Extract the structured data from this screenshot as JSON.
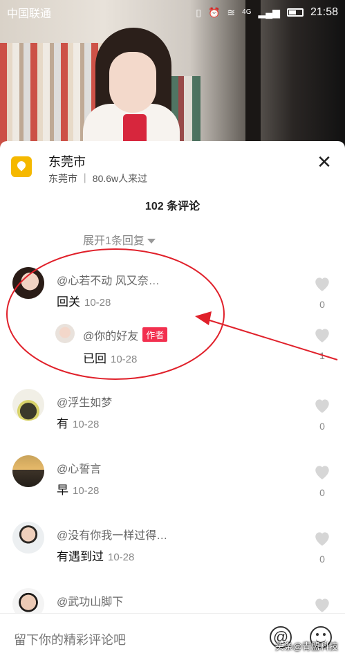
{
  "status_bar": {
    "carrier": "中国联通",
    "time": "21:58",
    "network_label": "4G"
  },
  "location": {
    "title": "东莞市",
    "subtitle": "东莞市 ｜ 80.6w人来过"
  },
  "comments_header": {
    "count_title": "102 条评论",
    "expand_label": "展开1条回复"
  },
  "comments": [
    {
      "user": "@心若不动 风又奈…",
      "text": "回关",
      "date": "10-28",
      "likes": "0"
    },
    {
      "user": "@浮生如梦",
      "text": "有",
      "date": "10-28",
      "likes": "0"
    },
    {
      "user": "@心誓言",
      "text": "早",
      "date": "10-28",
      "likes": "0"
    },
    {
      "user": "@没有你我一样过得…",
      "text": "有遇到过",
      "date": "10-28",
      "likes": "0"
    },
    {
      "user": "@武功山脚下",
      "text": "",
      "date": "",
      "likes": ""
    }
  ],
  "reply": {
    "user": "@你的好友",
    "tag": "作者",
    "text": "已回",
    "date": "10-28",
    "likes": "1"
  },
  "input": {
    "placeholder": "留下你的精彩评论吧"
  },
  "watermark": "头条@青盟科技",
  "colors": {
    "author_tag": "#f2304f",
    "annotation": "#e0202a",
    "location_icon": "#f5b800"
  }
}
